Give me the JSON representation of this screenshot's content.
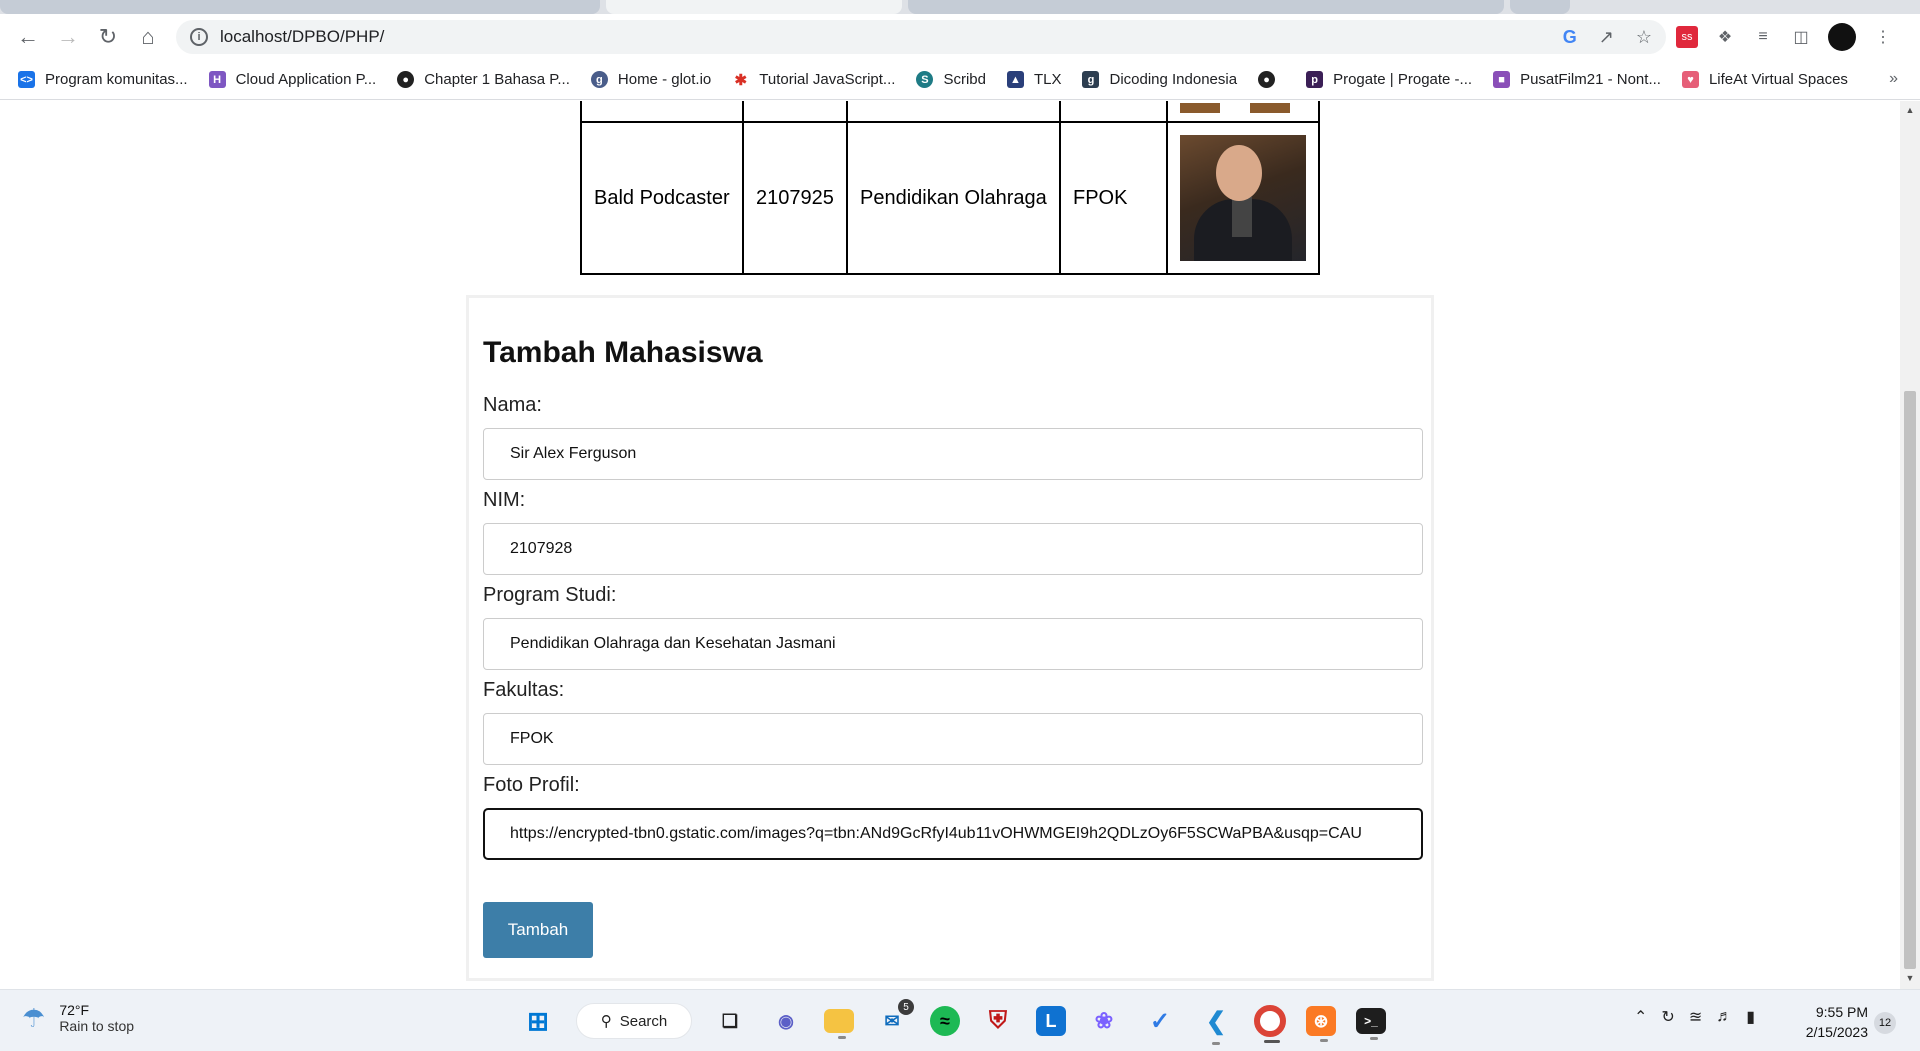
{
  "browser": {
    "url": "localhost/DPBO/PHP/",
    "bookmarks": [
      {
        "label": "Program komunitas...",
        "icon": "code-icon",
        "color": "#1a73e8"
      },
      {
        "label": "Cloud Application P...",
        "icon": "h-icon",
        "color": "#7e57c2"
      },
      {
        "label": "Chapter 1 Bahasa P...",
        "icon": "globe-icon",
        "color": "#222222"
      },
      {
        "label": "Home - glot.io",
        "icon": "glot-icon",
        "color": "#4a5d8a"
      },
      {
        "label": "Tutorial JavaScript...",
        "icon": "figure-icon",
        "color": "#d93025"
      },
      {
        "label": "Scribd",
        "icon": "scribd-icon",
        "color": "#1e7b85"
      },
      {
        "label": "TLX",
        "icon": "tlx-icon",
        "color": "#2a3f7a"
      },
      {
        "label": "Dicoding Indonesia",
        "icon": "dicoding-icon",
        "color": "#2d3e50"
      },
      {
        "label": "",
        "icon": "globe-icon",
        "color": "#222222"
      },
      {
        "label": "Progate | Progate -...",
        "icon": "progate-icon",
        "color": "#3b1f56"
      },
      {
        "label": "PusatFilm21 - Nont...",
        "icon": "film-icon",
        "color": "#8a4fb8"
      },
      {
        "label": "LifeAt Virtual Spaces",
        "icon": "lifeat-icon",
        "color": "#e65f78"
      }
    ],
    "bookmarks_more": "»"
  },
  "table": {
    "row": {
      "nama": "Bald Podcaster",
      "nim": "2107925",
      "prodi": "Pendidikan Olahraga",
      "fakultas": "FPOK"
    }
  },
  "form": {
    "title": "Tambah Mahasiswa",
    "fields": [
      {
        "label": "Nama:",
        "value": "Sir Alex Ferguson"
      },
      {
        "label": "NIM:",
        "value": "2107928"
      },
      {
        "label": "Program Studi:",
        "value": "Pendidikan Olahraga dan Kesehatan Jasmani"
      },
      {
        "label": "Fakultas:",
        "value": "FPOK"
      },
      {
        "label": "Foto Profil:",
        "value": "https://encrypted-tbn0.gstatic.com/images?q=tbn:ANd9GcRfyI4ub11vOHWMGEI9h2QDLzOy6F5SCWaPBA&usqp=CAU"
      }
    ],
    "submit_label": "Tambah"
  },
  "taskbar": {
    "weather_temp": "72°F",
    "weather_desc": "Rain to stop",
    "search_label": "Search",
    "mail_badge": "5",
    "time": "9:55 PM",
    "date": "2/15/2023",
    "notifications": "12"
  }
}
